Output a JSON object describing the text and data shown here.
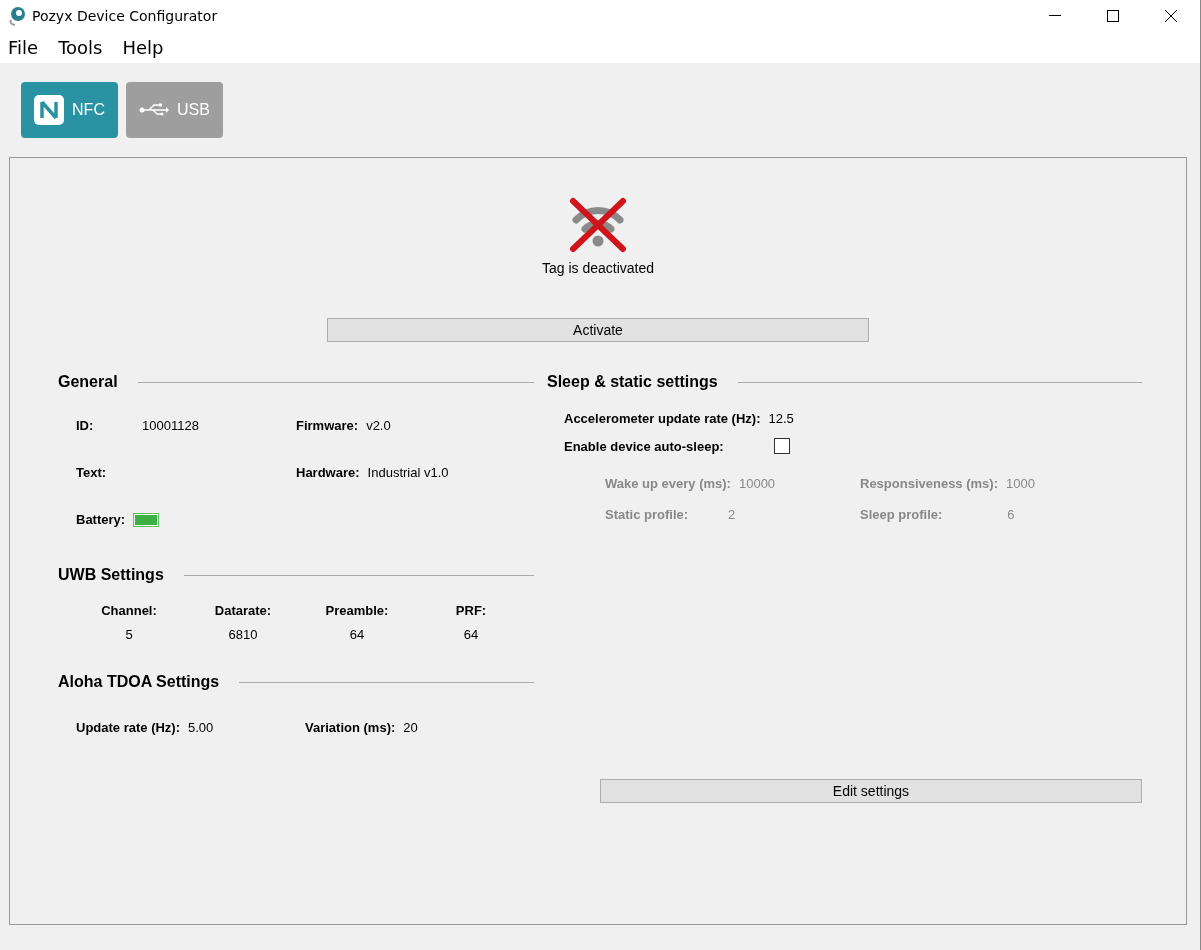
{
  "window": {
    "title": "Pozyx Device Configurator"
  },
  "menu": [
    "File",
    "Tools",
    "Help"
  ],
  "connections": [
    {
      "kind": "nfc",
      "label": "NFC",
      "selected": true
    },
    {
      "kind": "usb",
      "label": "USB",
      "selected": false
    }
  ],
  "status": {
    "active": false,
    "text": "Tag is deactivated"
  },
  "activate_button": "Activate",
  "general": {
    "title": "General",
    "fields": [
      {
        "kind": "text",
        "label": "ID:",
        "value": "10001128"
      },
      {
        "kind": "text",
        "label": "Firmware:",
        "value": "v2.0"
      },
      {
        "kind": "text",
        "label": "Text:"
      },
      {
        "kind": "text",
        "label": "Hardware:",
        "value": "Industrial v1.0"
      },
      {
        "kind": "battery",
        "label": "Battery:",
        "level": 1
      }
    ]
  },
  "uwb": {
    "title": "UWB Settings",
    "columns": [
      {
        "label": "Channel:",
        "value": "5"
      },
      {
        "label": "Datarate:",
        "value": "6810"
      },
      {
        "label": "Preamble:",
        "value": "64"
      },
      {
        "label": "PRF:",
        "value": "64"
      }
    ]
  },
  "aloha": {
    "title": "Aloha TDOA Settings",
    "fields": [
      {
        "label": "Update rate (Hz):",
        "value": "5.00"
      },
      {
        "label": "Variation (ms):",
        "value": "20"
      }
    ]
  },
  "sleep": {
    "title": "Sleep & static settings",
    "accelerometer": {
      "label": "Accelerometer update rate (Hz):",
      "value": "12.5"
    },
    "auto_sleep": {
      "label": "Enable device auto-sleep:",
      "checked": false
    },
    "fields": [
      {
        "label": "Wake up every (ms):",
        "value": "10000",
        "disabled": true
      },
      {
        "label": "Responsiveness (ms):",
        "value": "1000",
        "disabled": true
      },
      {
        "label": "Static profile:",
        "value": "2",
        "disabled": true
      },
      {
        "label": "Sleep profile:",
        "value": "6",
        "disabled": true
      }
    ]
  },
  "edit_button": "Edit settings"
}
